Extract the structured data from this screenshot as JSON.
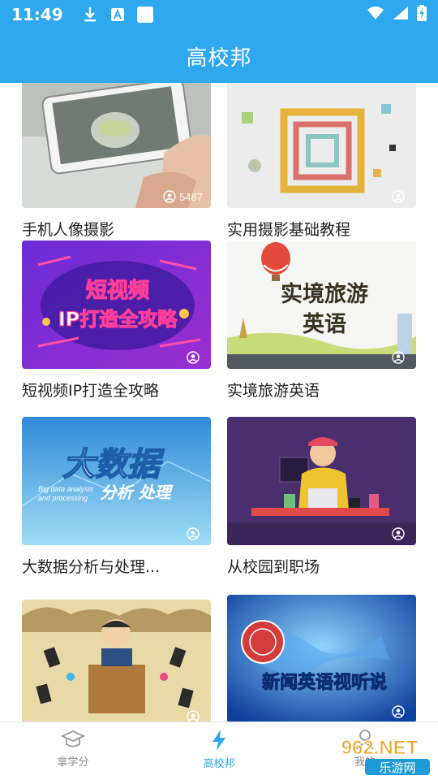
{
  "status_bar": {
    "time": "11:49",
    "icons": [
      "download-icon",
      "a-box-icon",
      "blank-box-icon"
    ],
    "right_icons": [
      "wifi-icon",
      "signal-icon",
      "battery-charging-icon"
    ]
  },
  "header": {
    "title": "高校邦"
  },
  "courses": [
    {
      "title": "手机人像摄影",
      "views": "5487",
      "theme": "phone-photography"
    },
    {
      "title": "实用摄影基础教程",
      "views": "",
      "theme": "photography-basics"
    },
    {
      "title": "短视频IP打造全攻略",
      "views": "",
      "theme": "short-video"
    },
    {
      "title": "实境旅游英语",
      "views": "",
      "theme": "travel-english"
    },
    {
      "title": "大数据分析与处理...",
      "views": "",
      "theme": "big-data"
    },
    {
      "title": "从校园到职场",
      "views": "",
      "theme": "campus-career"
    },
    {
      "title": "",
      "views": "",
      "theme": "presentation"
    },
    {
      "title": "",
      "views": "",
      "theme": "news-english"
    }
  ],
  "thumb_text": {
    "short_video_1": "短视频",
    "short_video_2": "IP打造全攻略",
    "travel_1": "实境旅游",
    "travel_2": "英语",
    "bigdata_main": "大数据",
    "bigdata_sub1": "Big data analysis",
    "bigdata_sub2": "and processing",
    "bigdata_sub3": "分析  处理",
    "news_english": "新闻英语视听说"
  },
  "bottom_nav": [
    {
      "label": "拿学分",
      "icon": "graduation-cap-icon",
      "active": false
    },
    {
      "label": "高校邦",
      "icon": "lightning-icon",
      "active": true
    },
    {
      "label": "我的",
      "icon": "person-icon",
      "active": false
    }
  ],
  "watermark": {
    "text": "962.NET",
    "subtext": "乐游网"
  },
  "colors": {
    "accent": "#2fa8f0",
    "title_text": "#222222",
    "inactive": "#8a8a8a"
  }
}
